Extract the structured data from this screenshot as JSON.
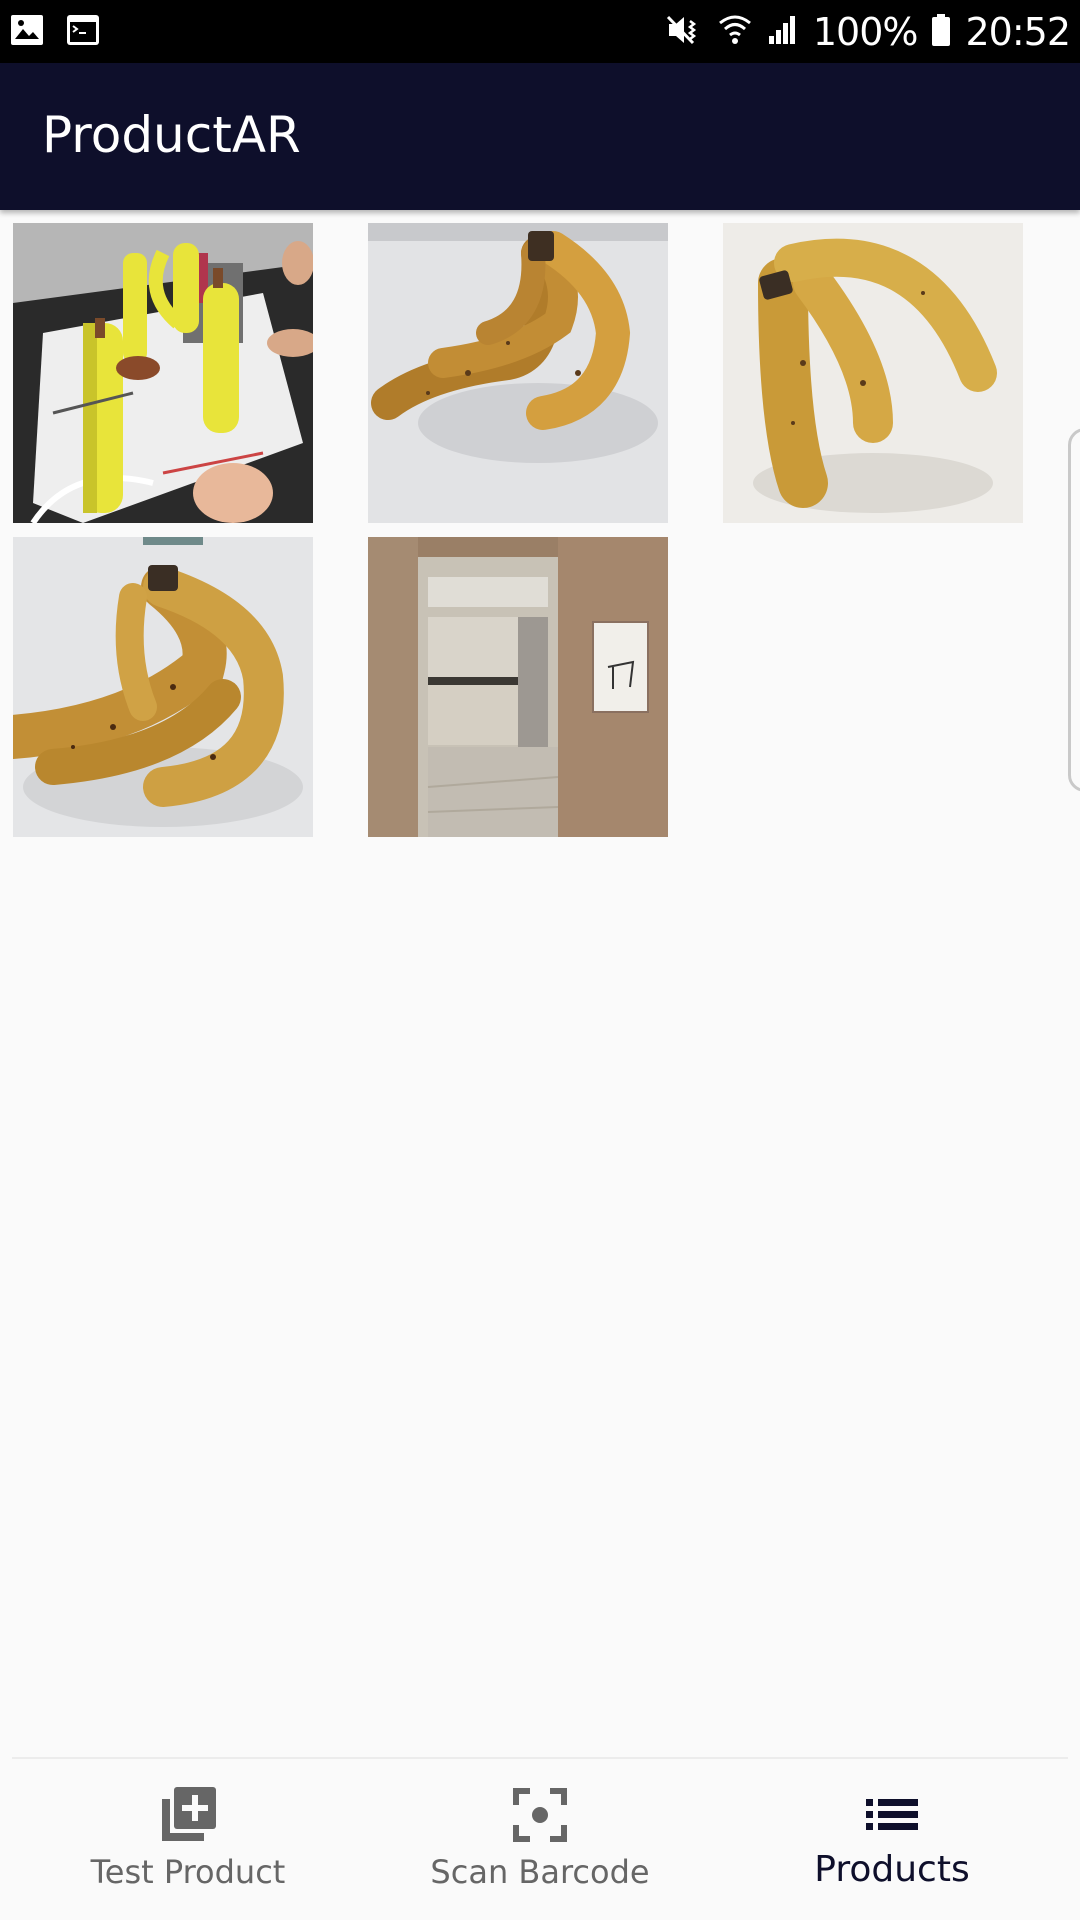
{
  "status_bar": {
    "battery": "100%",
    "time": "20:52",
    "icons_left": [
      "image-icon",
      "terminal-icon"
    ],
    "icons_right": [
      "mute-vibrate-icon",
      "wifi-icon",
      "signal-icon",
      "battery-icon"
    ]
  },
  "app_bar": {
    "title": "ProductAR",
    "background": "#0e0f2b"
  },
  "products": [
    {
      "name": "ar-bananas-table-photo",
      "icon": "ar-scene-image"
    },
    {
      "name": "banana-bunch-photo-1",
      "icon": "banana-image"
    },
    {
      "name": "banana-bunch-photo-2",
      "icon": "banana-image"
    },
    {
      "name": "banana-bunch-photo-3",
      "icon": "banana-image"
    },
    {
      "name": "room-doorway-photo",
      "icon": "room-image"
    }
  ],
  "bottom_nav": {
    "items": [
      {
        "label": "Test Product",
        "icon": "add-box-icon",
        "active": false
      },
      {
        "label": "Scan Barcode",
        "icon": "scan-focus-icon",
        "active": false
      },
      {
        "label": "Products",
        "icon": "list-icon",
        "active": true
      }
    ],
    "active_color": "#0e0f2b",
    "inactive_color": "#666666"
  }
}
